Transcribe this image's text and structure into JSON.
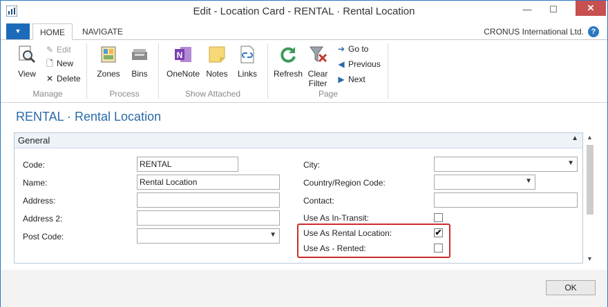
{
  "window": {
    "title": "Edit - Location Card - RENTAL · Rental Location",
    "minimize_glyph": "—",
    "maximize_glyph": "☐",
    "close_glyph": "✕"
  },
  "tabs": [
    {
      "label": "HOME"
    },
    {
      "label": "NAVIGATE"
    }
  ],
  "company": "CRONUS International Ltd.",
  "help_glyph": "?",
  "ribbon": {
    "groups": [
      {
        "label": "Manage"
      },
      {
        "label": "Process"
      },
      {
        "label": "Show Attached"
      },
      {
        "label": "Page"
      }
    ],
    "manage": {
      "view": "View",
      "edit": "Edit",
      "new": "New",
      "delete": "Delete"
    },
    "process": {
      "zones": "Zones",
      "bins": "Bins"
    },
    "show_attached": {
      "onenote": "OneNote",
      "notes": "Notes",
      "links": "Links"
    },
    "page": {
      "refresh": "Refresh",
      "clear_filter_1": "Clear",
      "clear_filter_2": "Filter",
      "goto": "Go to",
      "previous": "Previous",
      "next": "Next"
    }
  },
  "page_title": "RENTAL · Rental Location",
  "fasttab": {
    "title": "General"
  },
  "fields_left": [
    {
      "label": "Code:",
      "value": "RENTAL"
    },
    {
      "label": "Name:",
      "value": "Rental Location"
    },
    {
      "label": "Address:",
      "value": ""
    },
    {
      "label": "Address 2:",
      "value": ""
    },
    {
      "label": "Post Code:",
      "value": ""
    }
  ],
  "fields_right": [
    {
      "label": "City:",
      "value": ""
    },
    {
      "label": "Country/Region Code:",
      "value": ""
    },
    {
      "label": "Contact:",
      "value": ""
    },
    {
      "label": "Use As In-Transit:",
      "checked": false
    },
    {
      "label": "Use As Rental Location:",
      "checked": true
    },
    {
      "label": "Use As - Rented:",
      "checked": false
    }
  ],
  "ok_button": "OK",
  "colors": {
    "accent": "#2b78c2",
    "highlight": "#cc2a2a",
    "page_title": "#2b6aa8"
  }
}
